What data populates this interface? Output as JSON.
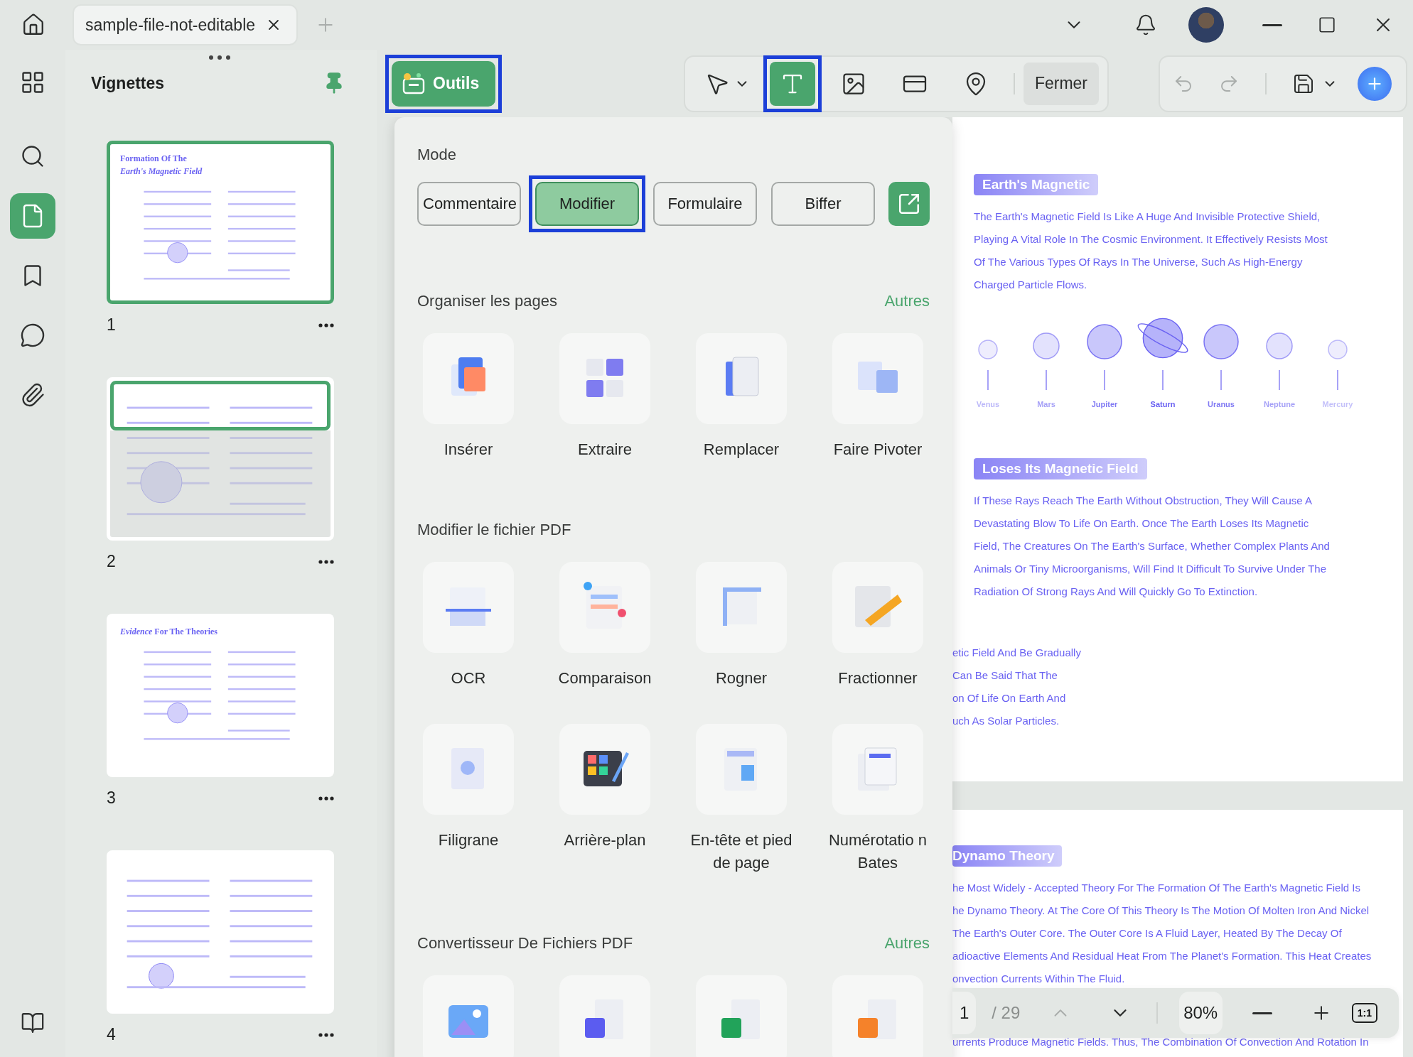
{
  "tabs": [
    {
      "label": "sample-file-not-editable",
      "selected": true
    }
  ],
  "rail": [
    {
      "kind": "apps",
      "selected": false
    },
    {
      "kind": "search",
      "selected": false
    },
    {
      "kind": "pages",
      "selected": true
    },
    {
      "kind": "bookmarks",
      "selected": false
    },
    {
      "kind": "comments",
      "selected": false
    },
    {
      "kind": "attachments",
      "selected": false
    }
  ],
  "rail_bottom": [
    {
      "kind": "library",
      "selected": false
    }
  ],
  "thumbnails": {
    "title": "Vignettes",
    "pinned": true,
    "pages": [
      {
        "number": "1",
        "selected": true,
        "in_view": false,
        "title": [
          "Formation Of The",
          "*Earth's Magnetic Field*"
        ]
      },
      {
        "number": "2",
        "selected": false,
        "in_view": true
      },
      {
        "number": "3",
        "selected": false,
        "in_view": false,
        "title": [
          "*Evidence* For The Theories"
        ]
      },
      {
        "number": "4",
        "selected": false,
        "in_view": false
      }
    ]
  },
  "toolbar": {
    "tools_button": {
      "label": "Outils",
      "highlighted": true
    },
    "tools": [
      {
        "kind": "select",
        "selected": false,
        "highlighted": false
      },
      {
        "kind": "text",
        "selected": true,
        "highlighted": true
      },
      {
        "kind": "image",
        "selected": false,
        "highlighted": false
      },
      {
        "kind": "link",
        "selected": false,
        "highlighted": false
      },
      {
        "kind": "location",
        "selected": false,
        "highlighted": false
      }
    ],
    "close_label": "Fermer",
    "history": [
      {
        "kind": "undo",
        "disabled": true
      },
      {
        "kind": "redo",
        "disabled": true
      }
    ]
  },
  "menu": {
    "mode": {
      "title": "Mode",
      "options": [
        {
          "label": "Commentaire",
          "selected": false,
          "highlighted": false
        },
        {
          "label": "Modifier",
          "selected": true,
          "highlighted": true
        },
        {
          "label": "Formulaire",
          "selected": false,
          "highlighted": false
        },
        {
          "label": "Biffer",
          "selected": false,
          "highlighted": false
        }
      ]
    },
    "sections": [
      {
        "title": "Organiser les pages",
        "more": "Autres",
        "tools": [
          {
            "kind": "insert",
            "label": "Insérer"
          },
          {
            "kind": "extract",
            "label": "Extraire"
          },
          {
            "kind": "replace",
            "label": "Remplacer"
          },
          {
            "kind": "rotate",
            "label": "Faire Pivoter"
          }
        ]
      },
      {
        "title": "Modifier le fichier PDF",
        "tools": [
          {
            "kind": "ocr",
            "label": "OCR"
          },
          {
            "kind": "compare",
            "label": "Comparaison"
          },
          {
            "kind": "crop",
            "label": "Rogner"
          },
          {
            "kind": "split",
            "label": "Fractionner"
          },
          {
            "kind": "watermark",
            "label": "Filigrane"
          },
          {
            "kind": "background",
            "label": "Arrière-plan"
          },
          {
            "kind": "header",
            "label": "En-tête et pied de page"
          },
          {
            "kind": "bates",
            "label": "Numérotatio n Bates"
          }
        ]
      },
      {
        "title": "Convertisseur De Fichiers PDF",
        "more": "Autres",
        "tools": [
          {
            "kind": "to-image"
          },
          {
            "kind": "to-word"
          },
          {
            "kind": "to-excel"
          },
          {
            "kind": "to-ppt"
          }
        ]
      }
    ]
  },
  "document": {
    "pages": [
      {
        "blocks": [
          {
            "kind": "heading",
            "text": "Earth's Magnetic",
            "clipped": false
          },
          {
            "kind": "paragraph",
            "clipped": false,
            "lines": [
              "The Earth's Magnetic Field Is Like A Huge And Invisible Protective Shield,",
              "Playing A Vital Role In The Cosmic Environment. It Effectively Resists Most",
              "Of The Various Types Of Rays In The Universe, Such As High-Energy",
              "Charged Particle Flows."
            ]
          },
          {
            "kind": "planets",
            "planets": [
              {
                "name": "Venus",
                "kind": "plain"
              },
              {
                "name": "Mars",
                "kind": "plain"
              },
              {
                "name": "Jupiter",
                "kind": "plain"
              },
              {
                "name": "Saturn",
                "kind": "ringed"
              },
              {
                "name": "Uranus",
                "kind": "plain"
              },
              {
                "name": "Neptune",
                "kind": "plain"
              },
              {
                "name": "Mercury",
                "kind": "plain"
              }
            ]
          },
          {
            "kind": "heading",
            "text": "Loses Its Magnetic Field",
            "clipped": false
          },
          {
            "kind": "paragraph",
            "clipped": false,
            "lines": [
              "If These Rays Reach The Earth Without Obstruction, They Will Cause A",
              "Devastating Blow To Life On Earth. Once The Earth Loses Its Magnetic",
              "Field, The Creatures On The Earth's Surface, Whether Complex Plants And",
              "Animals Or Tiny Microorganisms, Will Find It Difficult To Survive Under The",
              "Radiation Of Strong Rays And Will Quickly Go To Extinction."
            ]
          },
          {
            "kind": "paragraph",
            "clipped": true,
            "lines": [
              "etic Field And Be Gradually",
              "Can Be Said That The",
              "on Of Life On Earth And",
              "uch As Solar Particles."
            ]
          }
        ]
      },
      {
        "blocks": [
          {
            "kind": "heading",
            "text": "Dynamo Theory",
            "clipped": true
          },
          {
            "kind": "paragraph",
            "clipped": true,
            "lines": [
              "he Most Widely - Accepted Theory For The Formation Of The Earth's Magnetic Field Is",
              "he Dynamo Theory. At The Core Of This Theory Is The Motion Of Molten Iron And Nickel",
              "The Earth's Outer Core. The Outer Core Is A Fluid Layer, Heated By The Decay Of",
              "adioactive Elements And Residual Heat From The Planet's Formation. This Heat Creates",
              "onvection Currents Within The Fluid."
            ]
          },
          {
            "kind": "paragraph",
            "clipped": true,
            "lines": [
              "urrents Produce Magnetic Fields. Thus, The Combination Of Convection And Rotation In"
            ]
          }
        ]
      }
    ]
  },
  "pager": {
    "page": "1",
    "total": "/ 29",
    "prev_disabled": true,
    "zoom": "80%",
    "actual_size": "1:1"
  }
}
